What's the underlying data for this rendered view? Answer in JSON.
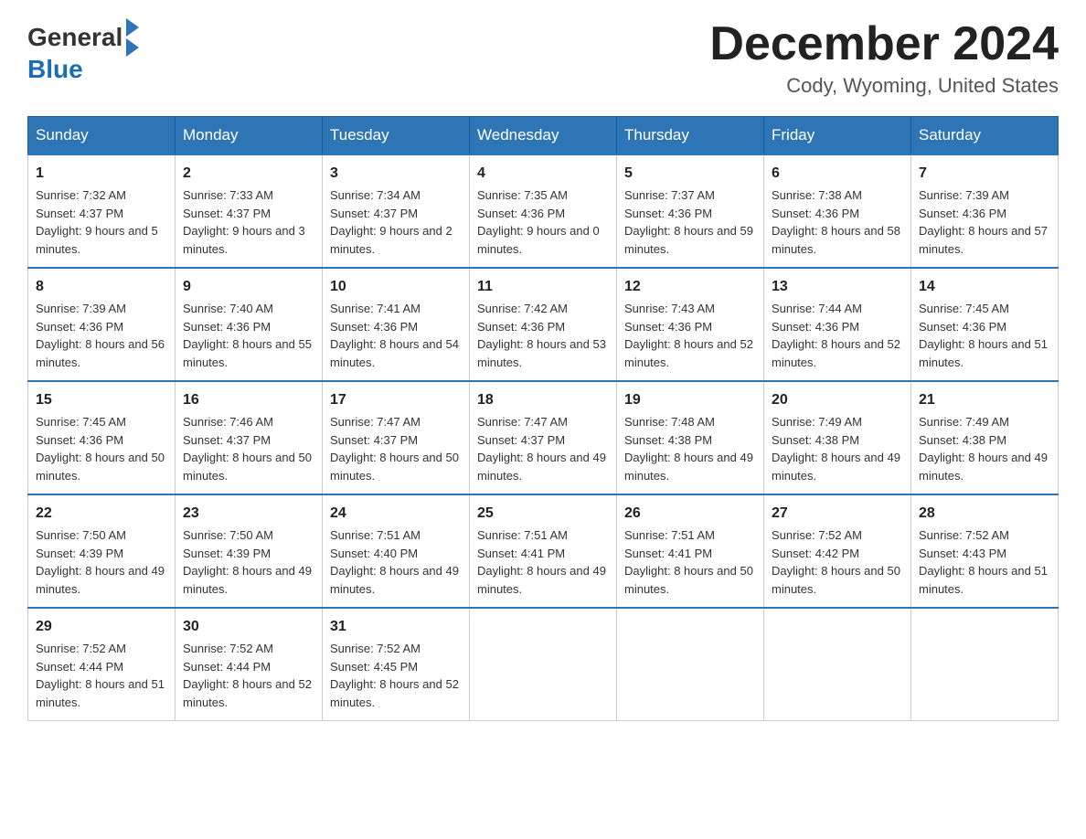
{
  "header": {
    "logo_general": "General",
    "logo_blue": "Blue",
    "title": "December 2024",
    "location": "Cody, Wyoming, United States"
  },
  "weekdays": [
    "Sunday",
    "Monday",
    "Tuesday",
    "Wednesday",
    "Thursday",
    "Friday",
    "Saturday"
  ],
  "weeks": [
    [
      {
        "day": "1",
        "sunrise": "7:32 AM",
        "sunset": "4:37 PM",
        "daylight": "9 hours and 5 minutes."
      },
      {
        "day": "2",
        "sunrise": "7:33 AM",
        "sunset": "4:37 PM",
        "daylight": "9 hours and 3 minutes."
      },
      {
        "day": "3",
        "sunrise": "7:34 AM",
        "sunset": "4:37 PM",
        "daylight": "9 hours and 2 minutes."
      },
      {
        "day": "4",
        "sunrise": "7:35 AM",
        "sunset": "4:36 PM",
        "daylight": "9 hours and 0 minutes."
      },
      {
        "day": "5",
        "sunrise": "7:37 AM",
        "sunset": "4:36 PM",
        "daylight": "8 hours and 59 minutes."
      },
      {
        "day": "6",
        "sunrise": "7:38 AM",
        "sunset": "4:36 PM",
        "daylight": "8 hours and 58 minutes."
      },
      {
        "day": "7",
        "sunrise": "7:39 AM",
        "sunset": "4:36 PM",
        "daylight": "8 hours and 57 minutes."
      }
    ],
    [
      {
        "day": "8",
        "sunrise": "7:39 AM",
        "sunset": "4:36 PM",
        "daylight": "8 hours and 56 minutes."
      },
      {
        "day": "9",
        "sunrise": "7:40 AM",
        "sunset": "4:36 PM",
        "daylight": "8 hours and 55 minutes."
      },
      {
        "day": "10",
        "sunrise": "7:41 AM",
        "sunset": "4:36 PM",
        "daylight": "8 hours and 54 minutes."
      },
      {
        "day": "11",
        "sunrise": "7:42 AM",
        "sunset": "4:36 PM",
        "daylight": "8 hours and 53 minutes."
      },
      {
        "day": "12",
        "sunrise": "7:43 AM",
        "sunset": "4:36 PM",
        "daylight": "8 hours and 52 minutes."
      },
      {
        "day": "13",
        "sunrise": "7:44 AM",
        "sunset": "4:36 PM",
        "daylight": "8 hours and 52 minutes."
      },
      {
        "day": "14",
        "sunrise": "7:45 AM",
        "sunset": "4:36 PM",
        "daylight": "8 hours and 51 minutes."
      }
    ],
    [
      {
        "day": "15",
        "sunrise": "7:45 AM",
        "sunset": "4:36 PM",
        "daylight": "8 hours and 50 minutes."
      },
      {
        "day": "16",
        "sunrise": "7:46 AM",
        "sunset": "4:37 PM",
        "daylight": "8 hours and 50 minutes."
      },
      {
        "day": "17",
        "sunrise": "7:47 AM",
        "sunset": "4:37 PM",
        "daylight": "8 hours and 50 minutes."
      },
      {
        "day": "18",
        "sunrise": "7:47 AM",
        "sunset": "4:37 PM",
        "daylight": "8 hours and 49 minutes."
      },
      {
        "day": "19",
        "sunrise": "7:48 AM",
        "sunset": "4:38 PM",
        "daylight": "8 hours and 49 minutes."
      },
      {
        "day": "20",
        "sunrise": "7:49 AM",
        "sunset": "4:38 PM",
        "daylight": "8 hours and 49 minutes."
      },
      {
        "day": "21",
        "sunrise": "7:49 AM",
        "sunset": "4:38 PM",
        "daylight": "8 hours and 49 minutes."
      }
    ],
    [
      {
        "day": "22",
        "sunrise": "7:50 AM",
        "sunset": "4:39 PM",
        "daylight": "8 hours and 49 minutes."
      },
      {
        "day": "23",
        "sunrise": "7:50 AM",
        "sunset": "4:39 PM",
        "daylight": "8 hours and 49 minutes."
      },
      {
        "day": "24",
        "sunrise": "7:51 AM",
        "sunset": "4:40 PM",
        "daylight": "8 hours and 49 minutes."
      },
      {
        "day": "25",
        "sunrise": "7:51 AM",
        "sunset": "4:41 PM",
        "daylight": "8 hours and 49 minutes."
      },
      {
        "day": "26",
        "sunrise": "7:51 AM",
        "sunset": "4:41 PM",
        "daylight": "8 hours and 50 minutes."
      },
      {
        "day": "27",
        "sunrise": "7:52 AM",
        "sunset": "4:42 PM",
        "daylight": "8 hours and 50 minutes."
      },
      {
        "day": "28",
        "sunrise": "7:52 AM",
        "sunset": "4:43 PM",
        "daylight": "8 hours and 51 minutes."
      }
    ],
    [
      {
        "day": "29",
        "sunrise": "7:52 AM",
        "sunset": "4:44 PM",
        "daylight": "8 hours and 51 minutes."
      },
      {
        "day": "30",
        "sunrise": "7:52 AM",
        "sunset": "4:44 PM",
        "daylight": "8 hours and 52 minutes."
      },
      {
        "day": "31",
        "sunrise": "7:52 AM",
        "sunset": "4:45 PM",
        "daylight": "8 hours and 52 minutes."
      },
      null,
      null,
      null,
      null
    ]
  ],
  "labels": {
    "sunrise": "Sunrise:",
    "sunset": "Sunset:",
    "daylight": "Daylight:"
  }
}
